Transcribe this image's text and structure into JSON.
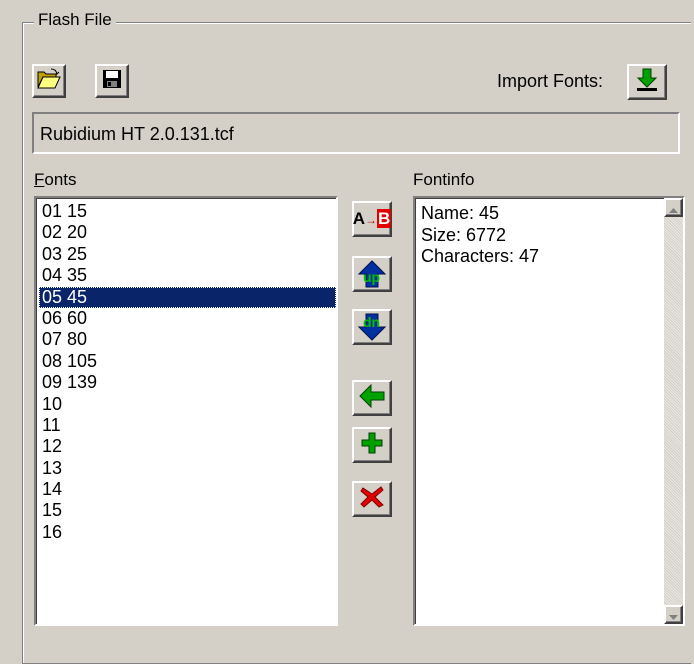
{
  "group": {
    "title": "Flash File"
  },
  "toolbar": {
    "import_label": "Import Fonts:"
  },
  "file": {
    "name": "Rubidium HT 2.0.131.tcf"
  },
  "fonts": {
    "label_first": "F",
    "label_rest": "onts",
    "items": [
      "01 15",
      "02 20",
      "03 25",
      "04 35",
      "05 45",
      "06 60",
      "07 80",
      "08 105",
      "09 139",
      "10",
      "11",
      "12",
      "13",
      "14",
      "15",
      "16"
    ],
    "selected_index": 4
  },
  "fontinfo": {
    "label": "Fontinfo",
    "name": "Name: 45",
    "size": "Size: 6772",
    "characters": "Characters: 47"
  },
  "actions": {
    "rename_text_a": "A",
    "rename_text_b": "B",
    "up_text": "up",
    "down_text": "dn"
  },
  "colors": {
    "selection": "#0a246a",
    "face": "#d4d0c8",
    "green": "#008000",
    "red": "#e00000"
  }
}
